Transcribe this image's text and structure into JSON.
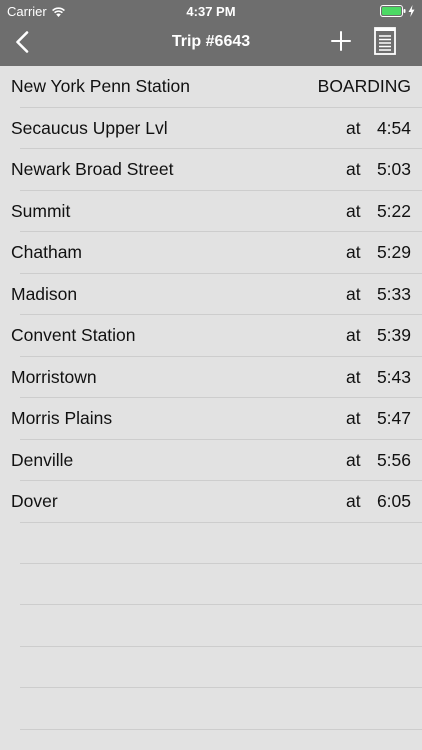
{
  "status_bar": {
    "carrier": "Carrier",
    "time": "4:37 PM",
    "icons": [
      "wifi-icon",
      "battery-icon",
      "charging-bolt-icon"
    ]
  },
  "nav": {
    "title": "Trip #6643",
    "back_icon": "chevron-left-icon",
    "add_icon": "plus-icon",
    "notes_icon": "notepad-icon"
  },
  "colors": {
    "nav_background": "#6e6e6e",
    "list_background": "#e2e2e2",
    "separator": "#cdcdcd",
    "text": "#111111"
  },
  "stops": [
    {
      "name": "New York Penn Station",
      "status": "BOARDING"
    },
    {
      "name": "Secaucus Upper Lvl",
      "at": "at",
      "time": "4:54"
    },
    {
      "name": "Newark Broad Street",
      "at": "at",
      "time": "5:03"
    },
    {
      "name": "Summit",
      "at": "at",
      "time": "5:22"
    },
    {
      "name": "Chatham",
      "at": "at",
      "time": "5:29"
    },
    {
      "name": "Madison",
      "at": "at",
      "time": "5:33"
    },
    {
      "name": "Convent Station",
      "at": "at",
      "time": "5:39"
    },
    {
      "name": "Morristown",
      "at": "at",
      "time": "5:43"
    },
    {
      "name": "Morris Plains",
      "at": "at",
      "time": "5:47"
    },
    {
      "name": "Denville",
      "at": "at",
      "time": "5:56"
    },
    {
      "name": "Dover",
      "at": "at",
      "time": "6:05"
    }
  ]
}
